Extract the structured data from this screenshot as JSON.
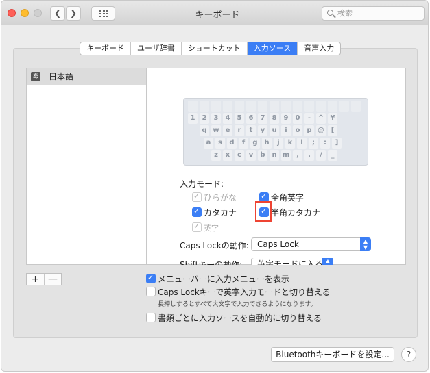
{
  "window": {
    "title": "キーボード"
  },
  "toolbar": {
    "back_icon": "chevron-left-icon",
    "forward_icon": "chevron-right-icon",
    "grid_icon": "grid-icon",
    "search_placeholder": "検索"
  },
  "tabs": [
    {
      "label": "キーボード",
      "active": false
    },
    {
      "label": "ユーザ辞書",
      "active": false
    },
    {
      "label": "ショートカット",
      "active": false
    },
    {
      "label": "入力ソース",
      "active": true
    },
    {
      "label": "音声入力",
      "active": false
    }
  ],
  "sources": [
    {
      "icon_text": "あ",
      "label": "日本語"
    }
  ],
  "keyboard": {
    "row1": [
      "1",
      "2",
      "3",
      "4",
      "5",
      "6",
      "7",
      "8",
      "9",
      "0",
      "-",
      "^",
      "¥"
    ],
    "row2": [
      "q",
      "w",
      "e",
      "r",
      "t",
      "y",
      "u",
      "i",
      "o",
      "p",
      "@",
      "["
    ],
    "row3": [
      "a",
      "s",
      "d",
      "f",
      "g",
      "h",
      "j",
      "k",
      "l",
      ";",
      ":",
      "]"
    ],
    "row4": [
      "z",
      "x",
      "c",
      "v",
      "b",
      "n",
      "m",
      ",",
      ".",
      "/",
      "_"
    ]
  },
  "input_mode": {
    "label": "入力モード:",
    "hiragana": {
      "label": "ひらがな",
      "checked": true,
      "disabled": true
    },
    "zenkaku_eiji": {
      "label": "全角英字",
      "checked": true
    },
    "katakana": {
      "label": "カタカナ",
      "checked": true
    },
    "hankaku_katakana": {
      "label": "半角カタカナ",
      "checked": true
    },
    "eiji": {
      "label": "英字",
      "checked": true,
      "disabled": true
    }
  },
  "caps_lock": {
    "label": "Caps Lockの動作:",
    "value": "Caps Lock"
  },
  "shift_key": {
    "label": "Shiftキーの動作:",
    "value": "英字モードに入る"
  },
  "list_buttons": {
    "add": "+",
    "remove": "—"
  },
  "options": {
    "show_menu": {
      "label": "メニューバーに入力メニューを表示",
      "checked": true
    },
    "caps_switch": {
      "label": "Caps Lockキーで英字入力モードと切り替える",
      "checked": false,
      "hint": "長押しするとすべて大文字で入力できるようになります。"
    },
    "auto_switch": {
      "label": "書類ごとに入力ソースを自動的に切り替える",
      "checked": false
    }
  },
  "footer": {
    "bluetooth_button": "Bluetoothキーボードを設定...",
    "help": "?"
  }
}
